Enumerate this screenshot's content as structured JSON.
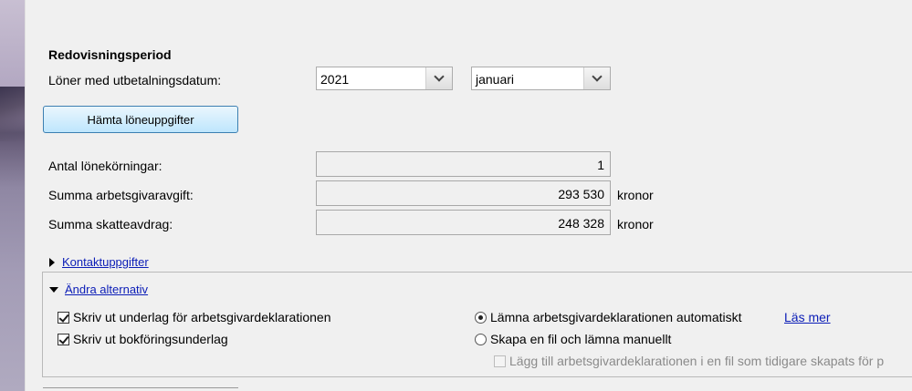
{
  "period": {
    "title": "Redovisningsperiod",
    "date_label": "Löner med utbetalningsdatum:",
    "year_value": "2021",
    "month_value": "januari",
    "fetch_button": "Hämta löneuppgifter"
  },
  "summary": {
    "runs_label": "Antal lönekörningar:",
    "runs_value": "1",
    "employer_fee_label": "Summa arbetsgivaravgift:",
    "employer_fee_value": "293 530",
    "employer_fee_unit": "kronor",
    "tax_label": "Summa skatteavdrag:",
    "tax_value": "248 328",
    "tax_unit": "kronor"
  },
  "contact": {
    "expander_label": "Kontaktuppgifter"
  },
  "options": {
    "expander_label": "Ändra alternativ",
    "print_basis_label": "Skriv ut underlag för arbetsgivardeklarationen",
    "print_basis_checked": true,
    "print_book_label": "Skriv ut bokföringsunderlag",
    "print_book_checked": true,
    "auto_submit_label": "Lämna arbetsgivardeklarationen automatiskt",
    "read_more_label": "Läs mer",
    "file_manual_label": "Skapa en fil och lämna manuellt",
    "append_file_label": "Lägg till arbetsgivardeklarationen i en fil som tidigare skapats för p"
  }
}
